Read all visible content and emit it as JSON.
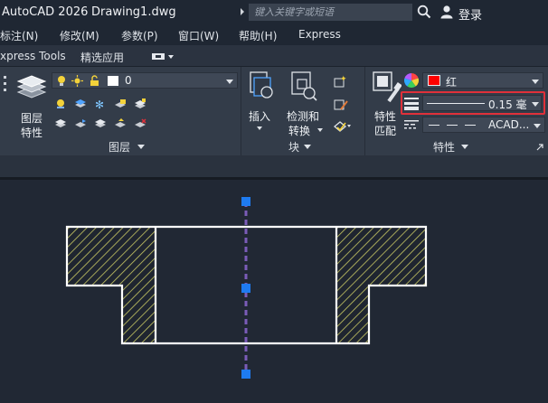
{
  "titlebar": {
    "app_name": "AutoCAD 2026",
    "document": "Drawing1.dwg",
    "search_placeholder": "键入关键字或短语",
    "login_label": "登录"
  },
  "menubar": {
    "items": [
      "标注(N)",
      "修改(M)",
      "参数(P)",
      "窗口(W)",
      "帮助(H)",
      "Express"
    ]
  },
  "ribbon_tabs": {
    "items": [
      "xpress Tools",
      "精选应用"
    ]
  },
  "ribbon": {
    "layers": {
      "big_button_label": [
        "图层",
        "特性"
      ],
      "layer_value": "0",
      "panel_title": "图层"
    },
    "insert": {
      "label": "插入"
    },
    "block_editor": {
      "label": [
        "检测和",
        "转换"
      ],
      "panel_title": "块"
    },
    "properties": {
      "match_label": [
        "特性",
        "匹配"
      ],
      "color_value": "红",
      "lineweight_value": "0.15 毫",
      "linetype_value": "ACAD...",
      "panel_title": "特性",
      "color_swatch": "#ff0000",
      "highlight_color": "#e0303a"
    }
  },
  "drawing": {
    "hatch_color": "#c8c864",
    "outline_color": "#ffffff",
    "centerline_color": "#7a5cb8",
    "grip_color": "#1e7bf0"
  }
}
